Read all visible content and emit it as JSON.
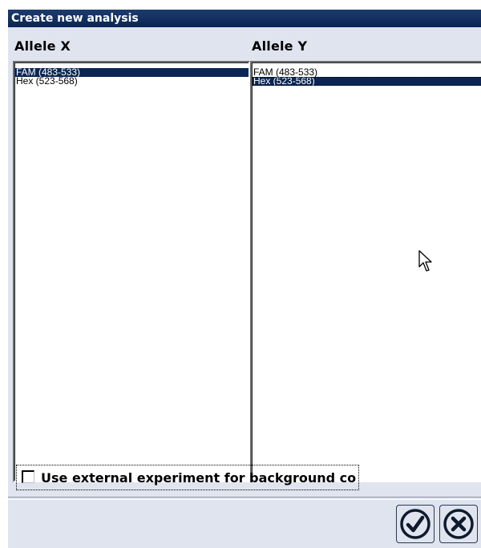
{
  "window": {
    "title": "Create new analysis"
  },
  "allele_x": {
    "header": "Allele X",
    "items": [
      {
        "label": "FAM (483-533)",
        "selected": true
      },
      {
        "label": "Hex (523-568)",
        "selected": false
      }
    ]
  },
  "allele_y": {
    "header": "Allele Y",
    "items": [
      {
        "label": "FAM (483-533)",
        "selected": false
      },
      {
        "label": "Hex (523-568)",
        "selected": true
      }
    ]
  },
  "options": {
    "external_experiment_label": "Use external experiment for background co",
    "external_experiment_checked": false
  },
  "buttons": {
    "ok_icon": "check-circle-icon",
    "cancel_icon": "x-circle-icon"
  },
  "colors": {
    "title_bg": "#0b2654",
    "dialog_bg": "#dfe4ee",
    "selection_bg": "#0b2654"
  }
}
